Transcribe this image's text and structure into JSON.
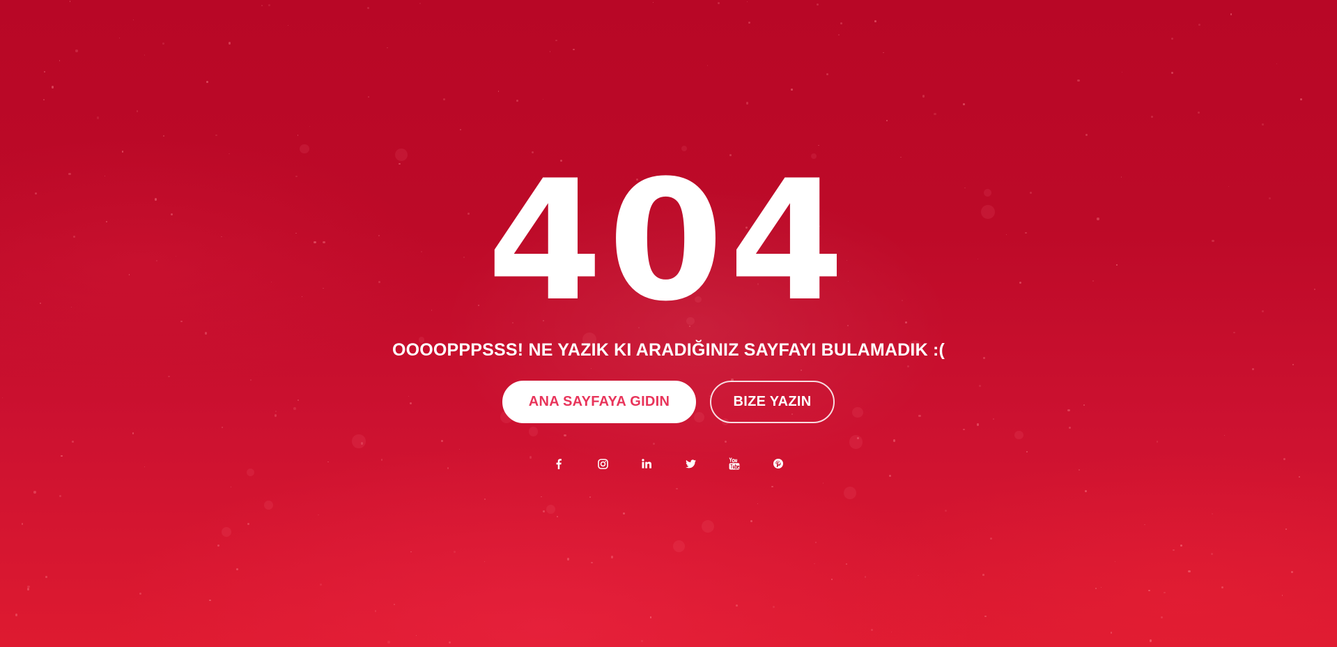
{
  "colors": {
    "background": "#bd0a28",
    "background_bottom": "#de1a30",
    "text": "#ffffff",
    "primary_button_text": "#e8345a",
    "primary_button_bg": "#ffffff"
  },
  "error": {
    "code": "404",
    "message": "OOOOPPPSSS! NE YAZIK KI ARADIĞINIZ SAYFAYI BULAMADIK :("
  },
  "buttons": {
    "home_label": "ANA SAYFAYA GIDIN",
    "contact_label": "BIZE YAZIN"
  },
  "social": [
    {
      "icon": "facebook-icon"
    },
    {
      "icon": "instagram-icon"
    },
    {
      "icon": "linkedin-icon"
    },
    {
      "icon": "twitter-icon"
    },
    {
      "icon": "youtube-icon"
    },
    {
      "icon": "pinterest-icon"
    }
  ]
}
